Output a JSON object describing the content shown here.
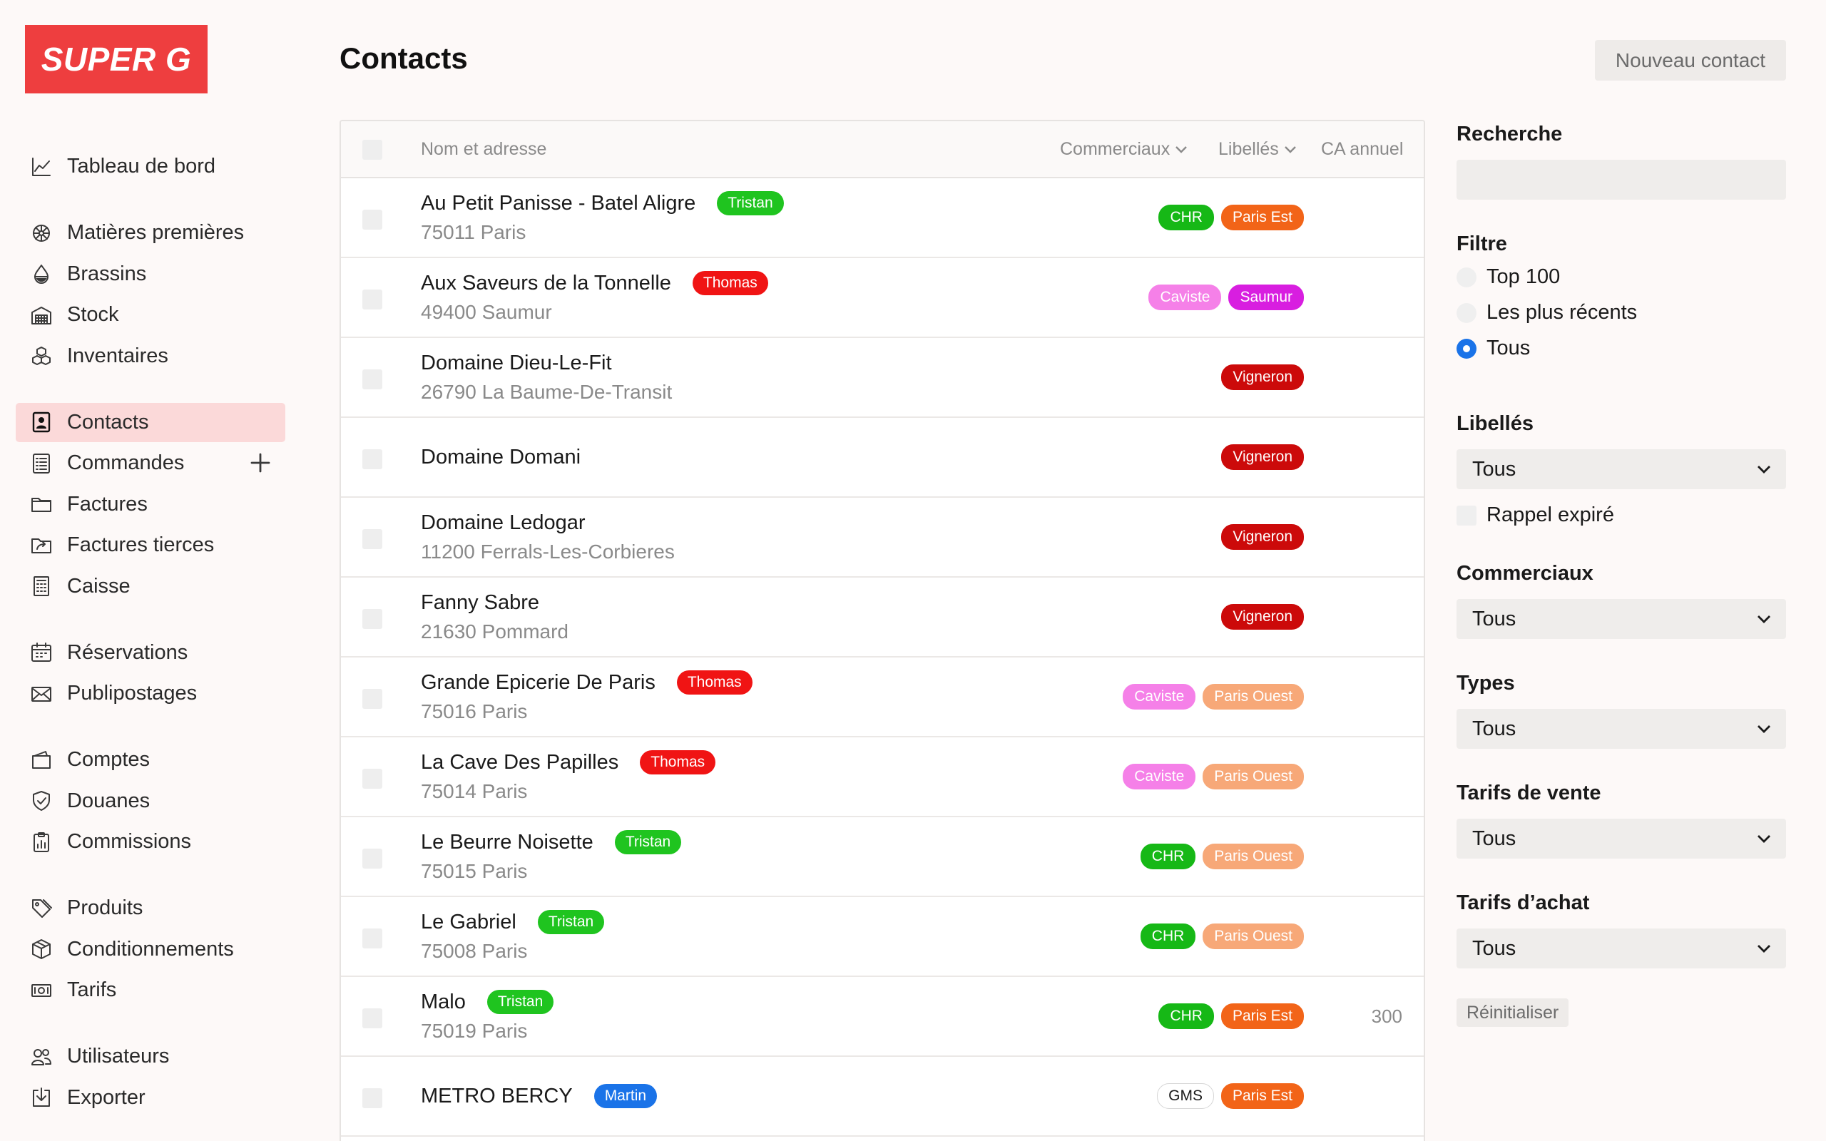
{
  "brand": {
    "logo_text": "SUPER G",
    "color": "#ee3e3f"
  },
  "header": {
    "title": "Contacts",
    "new_contact_label": "Nouveau contact"
  },
  "sidebar": {
    "groups": [
      [
        {
          "label": "Tableau de bord",
          "icon": "chart-line-icon"
        }
      ],
      [
        {
          "label": "Matières premières",
          "icon": "hop-icon"
        },
        {
          "label": "Brassins",
          "icon": "drop-icon"
        },
        {
          "label": "Stock",
          "icon": "warehouse-icon"
        },
        {
          "label": "Inventaires",
          "icon": "boxes-icon"
        }
      ],
      [
        {
          "label": "Contacts",
          "icon": "contact-card-icon",
          "active": true
        },
        {
          "label": "Commandes",
          "icon": "order-list-icon",
          "has_add": true
        },
        {
          "label": "Factures",
          "icon": "folder-icon"
        },
        {
          "label": "Factures tierces",
          "icon": "folder-arrow-icon"
        },
        {
          "label": "Caisse",
          "icon": "register-icon"
        }
      ],
      [
        {
          "label": "Réservations",
          "icon": "calendar-icon"
        },
        {
          "label": "Publipostages",
          "icon": "envelope-icon"
        }
      ],
      [
        {
          "label": "Comptes",
          "icon": "wallet-icon"
        },
        {
          "label": "Douanes",
          "icon": "shield-icon"
        },
        {
          "label": "Commissions",
          "icon": "clipboard-chart-icon"
        }
      ],
      [
        {
          "label": "Produits",
          "icon": "tag-icon"
        },
        {
          "label": "Conditionnements",
          "icon": "package-icon"
        },
        {
          "label": "Tarifs",
          "icon": "banknote-icon"
        }
      ],
      [
        {
          "label": "Utilisateurs",
          "icon": "users-icon"
        },
        {
          "label": "Exporter",
          "icon": "export-icon"
        }
      ]
    ]
  },
  "table": {
    "columns": {
      "name": "Nom et adresse",
      "commerciaux": "Commerciaux",
      "libelles": "Libellés",
      "ca": "CA annuel"
    },
    "rows": [
      {
        "name": "Au Petit Panisse - Batel Aligre",
        "address": "75011 Paris",
        "sales": "Tristan",
        "tags": [
          "CHR",
          "Paris Est"
        ],
        "ca": ""
      },
      {
        "name": "Aux Saveurs de la Tonnelle",
        "address": "49400 Saumur",
        "sales": "Thomas",
        "tags": [
          "Caviste",
          "Saumur"
        ],
        "ca": ""
      },
      {
        "name": "Domaine Dieu-Le-Fit",
        "address": "26790 La Baume-De-Transit",
        "sales": "",
        "tags": [
          "Vigneron"
        ],
        "ca": ""
      },
      {
        "name": "Domaine Domani",
        "address": "",
        "sales": "",
        "tags": [
          "Vigneron"
        ],
        "ca": ""
      },
      {
        "name": "Domaine Ledogar",
        "address": "11200 Ferrals-Les-Corbieres",
        "sales": "",
        "tags": [
          "Vigneron"
        ],
        "ca": ""
      },
      {
        "name": "Fanny Sabre",
        "address": "21630 Pommard",
        "sales": "",
        "tags": [
          "Vigneron"
        ],
        "ca": ""
      },
      {
        "name": "Grande Epicerie De Paris",
        "address": "75016 Paris",
        "sales": "Thomas",
        "tags": [
          "Caviste",
          "Paris Ouest"
        ],
        "ca": ""
      },
      {
        "name": "La Cave Des Papilles",
        "address": "75014 Paris",
        "sales": "Thomas",
        "tags": [
          "Caviste",
          "Paris Ouest"
        ],
        "ca": ""
      },
      {
        "name": "Le Beurre Noisette",
        "address": "75015 Paris",
        "sales": "Tristan",
        "tags": [
          "CHR",
          "Paris Ouest"
        ],
        "ca": ""
      },
      {
        "name": "Le Gabriel",
        "address": "75008 Paris",
        "sales": "Tristan",
        "tags": [
          "CHR",
          "Paris Ouest"
        ],
        "ca": ""
      },
      {
        "name": "Malo",
        "address": "75019 Paris",
        "sales": "Tristan",
        "tags": [
          "CHR",
          "Paris Est"
        ],
        "ca": "300"
      },
      {
        "name": "METRO BERCY",
        "address": "",
        "sales": "Martin",
        "tags": [
          "GMS",
          "Paris Est"
        ],
        "ca": ""
      }
    ]
  },
  "colors": {
    "sales": {
      "Tristan": "#1fc41f",
      "Thomas": "#f01414",
      "Martin": "#1a73e8"
    },
    "tags": {
      "CHR": {
        "bg": "#16b816",
        "fg": "#ffffff",
        "border": "#16b816"
      },
      "Paris Est": {
        "bg": "#f26418",
        "fg": "#ffffff",
        "border": "#f26418"
      },
      "Caviste": {
        "bg": "#f580e8",
        "fg": "#ffffff",
        "border": "#f580e8"
      },
      "Saumur": {
        "bg": "#d81ee0",
        "fg": "#ffffff",
        "border": "#d81ee0"
      },
      "Vigneron": {
        "bg": "#cc0a0a",
        "fg": "#ffffff",
        "border": "#cc0a0a"
      },
      "Paris Ouest": {
        "bg": "#f7a878",
        "fg": "#ffffff",
        "border": "#f7a878"
      },
      "GMS": {
        "bg": "#ffffff",
        "fg": "#1a1a1a",
        "border": "#d6d6d6"
      }
    }
  },
  "panel": {
    "search": {
      "title": "Recherche",
      "placeholder": ""
    },
    "filter": {
      "title": "Filtre",
      "options": [
        {
          "label": "Top 100",
          "checked": false
        },
        {
          "label": "Les plus récents",
          "checked": false
        },
        {
          "label": "Tous",
          "checked": true
        }
      ]
    },
    "libelles": {
      "title": "Libellés",
      "value": "Tous",
      "checkbox_label": "Rappel expiré"
    },
    "commerciaux": {
      "title": "Commerciaux",
      "value": "Tous"
    },
    "types": {
      "title": "Types",
      "value": "Tous"
    },
    "tarifs_vente": {
      "title": "Tarifs de vente",
      "value": "Tous"
    },
    "tarifs_achat": {
      "title": "Tarifs d’achat",
      "value": "Tous"
    },
    "reset_label": "Réinitialiser"
  }
}
